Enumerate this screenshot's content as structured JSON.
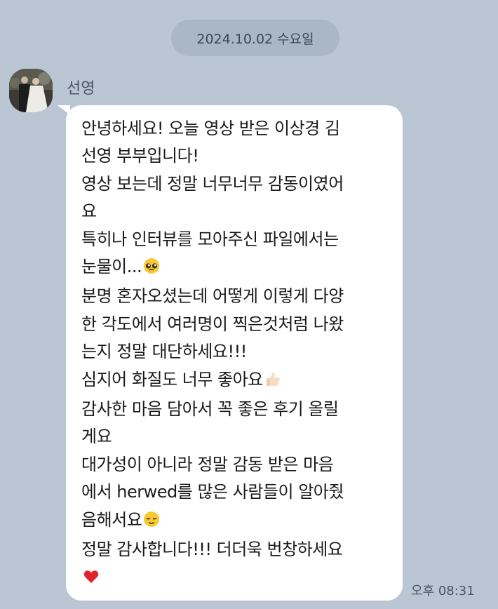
{
  "date_separator": "2024.10.02 수요일",
  "sender": {
    "name": "선영"
  },
  "message": {
    "lines": [
      "안녕하세요! 오늘 영상 받은 이상경 김",
      "선영 부부입니다!",
      "영상 보는데 정말 너무너무 감동이였어",
      "요",
      "특히나 인터뷰를 모아주신 파일에서는",
      "눈물이...",
      "분명 혼자오셨는데 어떻게 이렇게 다양",
      "한 각도에서 여러명이 찍은것처럼 나왔",
      "는지 정말 대단하세요!!!",
      "심지어 화질도 너무 좋아요",
      "감사한 마음 담아서 꼭 좋은 후기 올릴",
      "게요",
      "대가성이 아니라 정말 감동 받은 마음",
      "에서 herwed를 많은 사람들이 알아줬",
      "음해서요",
      "정말 감사합니다!!! 더더욱 번창하세요",
      ""
    ],
    "emojis": {
      "line_5": "pleading-face-emoji",
      "line_9": "thumbs-up-emoji",
      "line_14": "relieved-face-emoji",
      "line_16": "red-heart-emoji"
    },
    "time": "오후 08:31"
  },
  "colors": {
    "background": "#bac6d3",
    "date_pill": "#a9b7c6",
    "bubble": "#ffffff",
    "heart": "#e0242b"
  }
}
